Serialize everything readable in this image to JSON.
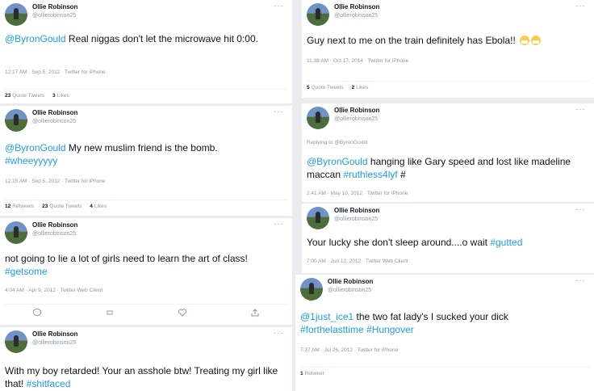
{
  "user": {
    "name": "Ollie Robinson",
    "handle": "@ollierobinson25"
  },
  "tweets": {
    "t1": {
      "mention": "@ByronGould",
      "text": " Real niggas don't let the microwave hit 0:00.",
      "meta": "12:17 AM · Sep 5, 2012 · Twitter for iPhone",
      "quote_count": "23",
      "quote_label": "Quote Tweets",
      "like_count": "3",
      "like_label": "Likes"
    },
    "t2": {
      "mention": "@ByronGould",
      "text": " My new muslim friend is the bomb.",
      "hashtag": "#wheeyyyyy",
      "meta": "12:15 AM · Sep 5, 2012 · Twitter for iPhone",
      "retweet_count": "12",
      "retweet_label": "Retweets",
      "quote_count": "23",
      "quote_label": "Quote Tweets",
      "like_count": "4",
      "like_label": "Likes"
    },
    "t3": {
      "text": "not going to lie a lot of girls need to learn the art of class! ",
      "hashtag": "#getsome",
      "meta": "4:04 AM · Apr 9, 2012 · Twitter Web Client"
    },
    "t4": {
      "text": "With my boy retarded! Your an asshole btw! Treating my girl like that! ",
      "hashtag": "#shitfaced"
    },
    "t5": {
      "text": "Guy next to me on the train definitely has Ebola!!",
      "meta": "11:38 AM · Oct 17, 2014 · Twitter for iPhone",
      "quote_count": "5",
      "quote_label": "Quote Tweets",
      "like_count": "2",
      "like_label": "Likes"
    },
    "t6": {
      "replying": "Replying to @ByronGould",
      "mention": "@ByronGould",
      "text": " hanging like Gary speed and lost like madeline maccan ",
      "hashtag": "#ruthless4lyf",
      "tail": " #",
      "meta": "2:41 AM · May 10, 2012 · Twitter for iPhone"
    },
    "t7": {
      "text": "Your lucky she don't sleep around....o wait ",
      "hashtag": "#gutted",
      "meta": "7:00 AM · Jun 12, 2012 · Twitter Web Client"
    },
    "t8": {
      "mention": "@1just_ice1",
      "text": " the two fat lady's I sucked your dick ",
      "hashtag1": "#forthelasttime",
      "hashtag2": "#Hungover",
      "meta": "7:37 AM · Jul 26, 2012 · Twitter for iPhone",
      "retweet_count": "1",
      "retweet_label": "Retweet"
    }
  },
  "icons": {
    "more": "···"
  },
  "colors": {
    "link": "#1d9bf0",
    "muted": "#8b98a5",
    "text": "#0f1419"
  }
}
